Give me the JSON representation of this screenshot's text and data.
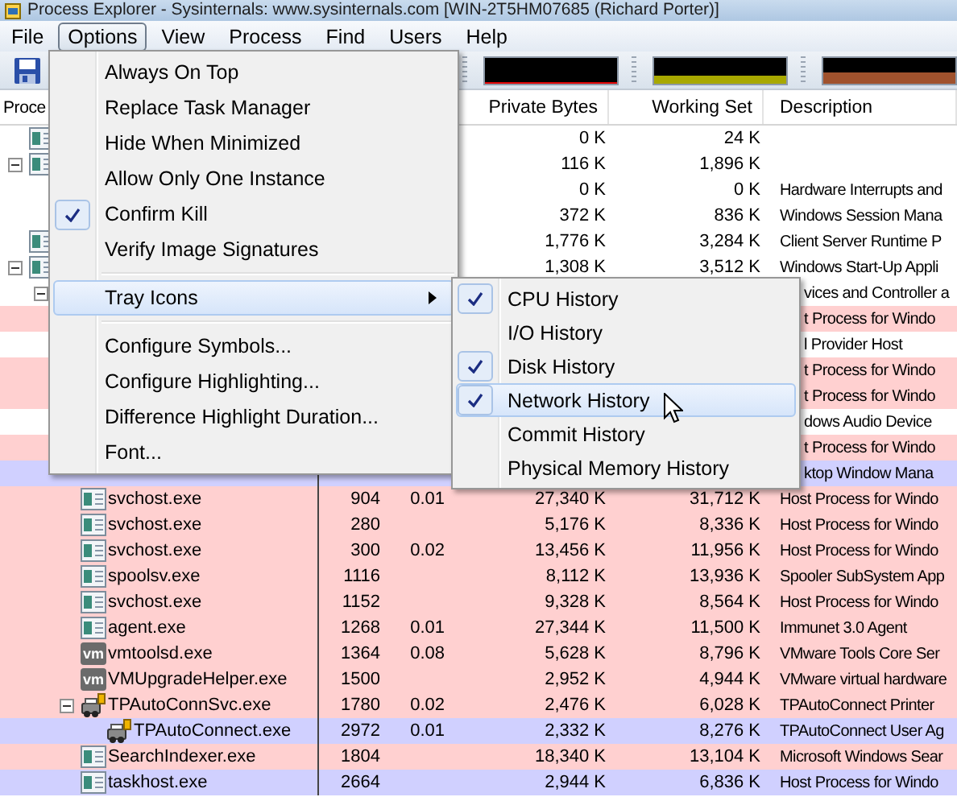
{
  "window": {
    "title": "Process Explorer - Sysinternals: www.sysinternals.com [WIN-2T5HM07685 (Richard Porter)]"
  },
  "menu_bar": [
    {
      "label": "File",
      "selected": false
    },
    {
      "label": "Options",
      "selected": true
    },
    {
      "label": "View",
      "selected": false
    },
    {
      "label": "Process",
      "selected": false
    },
    {
      "label": "Find",
      "selected": false
    },
    {
      "label": "Users",
      "selected": false
    },
    {
      "label": "Help",
      "selected": false
    }
  ],
  "toolbar": {
    "graphs": [
      {
        "color": "#e00000"
      },
      {
        "color": "#a8a800"
      },
      {
        "color": "#a0522d"
      }
    ]
  },
  "table": {
    "columns": [
      {
        "label": "Proce"
      },
      {
        "label": "Private Bytes"
      },
      {
        "label": "Working Set"
      },
      {
        "label": "Description"
      }
    ],
    "rows": [
      {
        "kind": "app",
        "private_bytes": "0 K",
        "working_set": "24 K",
        "color": "#ffffff"
      },
      {
        "kind": "app",
        "private_bytes": "116 K",
        "working_set": "1,896 K",
        "color": "#ffffff",
        "expanded": true,
        "children": [
          {
            "private_bytes": "0 K",
            "working_set": "0 K",
            "description": "Hardware Interrupts and",
            "color": "#ffffff"
          },
          {
            "private_bytes": "372 K",
            "working_set": "836 K",
            "description": "Windows Session Mana",
            "color": "#ffffff"
          }
        ]
      },
      {
        "kind": "app",
        "private_bytes": "1,776 K",
        "working_set": "3,284 K",
        "description": "Client Server Runtime P",
        "color": "#ffffff"
      },
      {
        "kind": "app",
        "private_bytes": "1,308 K",
        "working_set": "3,512 K",
        "description": "Windows Start-Up Appli",
        "color": "#ffffff",
        "expanded": true,
        "children": [
          {
            "description": "vices and Controller a",
            "color": "#ffffff",
            "expanded": true,
            "children": [
              {
                "description": "t Process for Windo",
                "color": "#ffd0d0"
              },
              {
                "description": "l Provider Host",
                "color": "#ffffff"
              },
              {
                "description": "t Process for Windo",
                "color": "#ffd0d0"
              },
              {
                "description": "t Process for Windo",
                "color": "#ffd0d0"
              },
              {
                "description": "dows Audio Device",
                "color": "#ffffff"
              },
              {
                "description": "t Process for Windo",
                "color": "#ffd0d0"
              },
              {
                "description": "ktop Window Mana",
                "color": "#d0d0ff"
              },
              {
                "kind": "app",
                "name": "svchost.exe",
                "pid": "904",
                "cpu": "0.01",
                "private_bytes": "27,340 K",
                "working_set": "31,712 K",
                "description": "Host Process for Windo",
                "color": "#ffd0d0"
              },
              {
                "kind": "app",
                "name": "svchost.exe",
                "pid": "280",
                "private_bytes": "5,176 K",
                "working_set": "8,336 K",
                "description": "Host Process for Windo",
                "color": "#ffd0d0"
              },
              {
                "kind": "app",
                "name": "svchost.exe",
                "pid": "300",
                "cpu": "0.02",
                "private_bytes": "13,456 K",
                "working_set": "11,956 K",
                "description": "Host Process for Windo",
                "color": "#ffd0d0"
              },
              {
                "kind": "app",
                "name": "spoolsv.exe",
                "pid": "1116",
                "private_bytes": "8,112 K",
                "working_set": "13,936 K",
                "description": "Spooler SubSystem App",
                "color": "#ffd0d0"
              },
              {
                "kind": "app",
                "name": "svchost.exe",
                "pid": "1152",
                "private_bytes": "9,328 K",
                "working_set": "8,564 K",
                "description": "Host Process for Windo",
                "color": "#ffd0d0"
              },
              {
                "kind": "app",
                "name": "agent.exe",
                "pid": "1268",
                "cpu": "0.01",
                "private_bytes": "27,344 K",
                "working_set": "11,500 K",
                "description": "Immunet 3.0 Agent",
                "color": "#ffd0d0"
              },
              {
                "kind": "logo",
                "badge": "vm",
                "name": "vmtoolsd.exe",
                "pid": "1364",
                "cpu": "0.08",
                "private_bytes": "5,628 K",
                "working_set": "8,796 K",
                "description": "VMware Tools Core Ser",
                "color": "#ffd0d0"
              },
              {
                "kind": "logo",
                "badge": "vm",
                "name": "VMUpgradeHelper.exe",
                "pid": "1500",
                "private_bytes": "2,952 K",
                "working_set": "4,944 K",
                "description": "VMware virtual hardware",
                "color": "#ffd0d0"
              },
              {
                "kind": "service",
                "name": "TPAutoConnSvc.exe",
                "pid": "1780",
                "cpu": "0.02",
                "private_bytes": "2,476 K",
                "working_set": "6,028 K",
                "description": "TPAutoConnect Printer",
                "color": "#ffd0d0",
                "expanded": true,
                "children": [
                  {
                    "kind": "service",
                    "name": "TPAutoConnect.exe",
                    "pid": "2972",
                    "cpu": "0.01",
                    "private_bytes": "2,332 K",
                    "working_set": "8,276 K",
                    "description": "TPAutoConnect User Ag",
                    "color": "#d0d0ff"
                  }
                ]
              },
              {
                "kind": "app",
                "name": "SearchIndexer.exe",
                "pid": "1804",
                "private_bytes": "18,340 K",
                "working_set": "13,104 K",
                "description": "Microsoft Windows Sear",
                "color": "#ffd0d0"
              },
              {
                "kind": "app",
                "name": "taskhost.exe",
                "pid": "2664",
                "private_bytes": "2,944 K",
                "working_set": "6,836 K",
                "description": "Host Process for Windo",
                "color": "#d0d0ff"
              }
            ]
          }
        ]
      }
    ]
  },
  "options_menu": {
    "items": [
      {
        "kind": "item",
        "label": "Always On Top",
        "checked": false,
        "selected": false
      },
      {
        "kind": "item",
        "label": "Replace Task Manager",
        "checked": false,
        "selected": false
      },
      {
        "kind": "item",
        "label": "Hide When Minimized",
        "checked": false,
        "selected": false
      },
      {
        "kind": "item",
        "label": "Allow Only One Instance",
        "checked": false,
        "selected": false
      },
      {
        "kind": "item",
        "label": "Confirm Kill",
        "checked": true,
        "selected": false
      },
      {
        "kind": "item",
        "label": "Verify Image Signatures",
        "checked": false,
        "selected": false
      },
      {
        "kind": "separator"
      },
      {
        "kind": "submenu",
        "label": "Tray Icons",
        "checked": false,
        "selected": true
      },
      {
        "kind": "separator"
      },
      {
        "kind": "item",
        "label": "Configure Symbols...",
        "checked": false,
        "selected": false
      },
      {
        "kind": "item",
        "label": "Configure Highlighting...",
        "checked": false,
        "selected": false
      },
      {
        "kind": "item",
        "label": "Difference Highlight Duration...",
        "checked": false,
        "selected": false
      },
      {
        "kind": "item",
        "label": "Font...",
        "checked": false,
        "selected": false
      }
    ]
  },
  "tray_icons_menu": {
    "items": [
      {
        "kind": "item",
        "label": "CPU History",
        "checked": true,
        "selected": false
      },
      {
        "kind": "item",
        "label": "I/O History",
        "checked": false,
        "selected": false
      },
      {
        "kind": "item",
        "label": "Disk History",
        "checked": true,
        "selected": false
      },
      {
        "kind": "item",
        "label": "Network History",
        "checked": true,
        "selected": true
      },
      {
        "kind": "item",
        "label": "Commit History",
        "checked": false,
        "selected": false
      },
      {
        "kind": "item",
        "label": "Physical Memory History",
        "checked": false,
        "selected": false
      }
    ]
  }
}
